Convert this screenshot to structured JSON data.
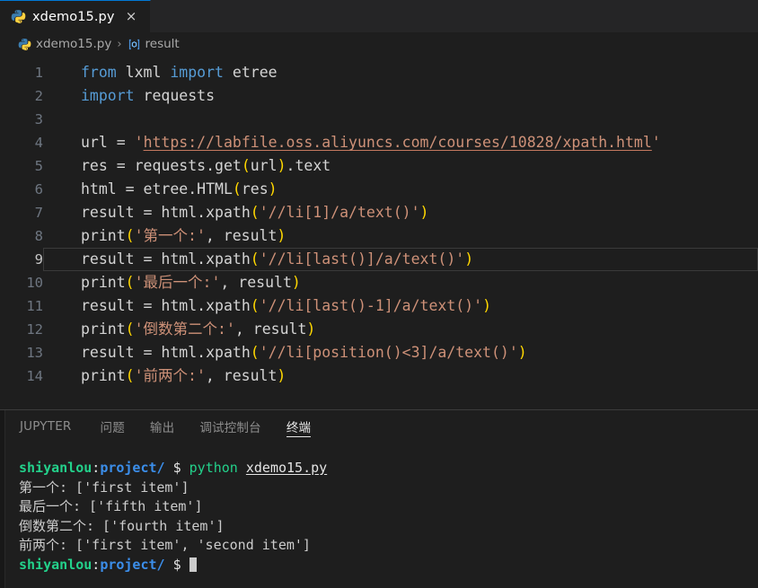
{
  "window": {
    "theme": "dark",
    "accent_color": "#0078d4",
    "editor_background": "#1e1e1e",
    "tabbar_background": "#252526"
  },
  "tabbar": {
    "tabs": [
      {
        "label": "xdemo15.py",
        "icon": "python-file-icon",
        "active": true,
        "close_label": "×"
      }
    ]
  },
  "breadcrumb": {
    "items": [
      {
        "label": "xdemo15.py",
        "icon": "python-file-icon"
      },
      {
        "label": "result",
        "icon": "symbol-variable-icon"
      }
    ],
    "separator": "›"
  },
  "editor": {
    "language": "python",
    "active_line": 9,
    "lines": [
      {
        "number": "1",
        "tokens": [
          {
            "t": "from",
            "c": "t-kw"
          },
          {
            "t": " lxml ",
            "c": "t-var"
          },
          {
            "t": "import",
            "c": "t-kw"
          },
          {
            "t": " etree",
            "c": "t-var"
          }
        ]
      },
      {
        "number": "2",
        "tokens": [
          {
            "t": "import",
            "c": "t-kw"
          },
          {
            "t": " requests",
            "c": "t-var"
          }
        ]
      },
      {
        "number": "3",
        "tokens": []
      },
      {
        "number": "4",
        "tokens": [
          {
            "t": "url ",
            "c": "t-var"
          },
          {
            "t": "= ",
            "c": "t-op"
          },
          {
            "t": "'",
            "c": "t-str"
          },
          {
            "t": "https://labfile.oss.aliyuncs.com/courses/10828/xpath.html",
            "c": "t-str-link"
          },
          {
            "t": "'",
            "c": "t-str"
          }
        ]
      },
      {
        "number": "5",
        "tokens": [
          {
            "t": "res ",
            "c": "t-var"
          },
          {
            "t": "= ",
            "c": "t-op"
          },
          {
            "t": "requests.get",
            "c": "t-var"
          },
          {
            "t": "(",
            "c": "t-p1"
          },
          {
            "t": "url",
            "c": "t-var"
          },
          {
            "t": ")",
            "c": "t-p1"
          },
          {
            "t": ".text",
            "c": "t-var"
          }
        ]
      },
      {
        "number": "6",
        "tokens": [
          {
            "t": "html ",
            "c": "t-var"
          },
          {
            "t": "= ",
            "c": "t-op"
          },
          {
            "t": "etree.HTML",
            "c": "t-var"
          },
          {
            "t": "(",
            "c": "t-p1"
          },
          {
            "t": "res",
            "c": "t-var"
          },
          {
            "t": ")",
            "c": "t-p1"
          }
        ]
      },
      {
        "number": "7",
        "tokens": [
          {
            "t": "result ",
            "c": "t-var"
          },
          {
            "t": "= ",
            "c": "t-op"
          },
          {
            "t": "html.xpath",
            "c": "t-var"
          },
          {
            "t": "(",
            "c": "t-p1"
          },
          {
            "t": "'//li[1]/a/text()'",
            "c": "t-str"
          },
          {
            "t": ")",
            "c": "t-p1"
          }
        ]
      },
      {
        "number": "8",
        "tokens": [
          {
            "t": "print",
            "c": "t-var"
          },
          {
            "t": "(",
            "c": "t-p1"
          },
          {
            "t": "'第一个:'",
            "c": "t-str"
          },
          {
            "t": ", ",
            "c": "t-op"
          },
          {
            "t": "result",
            "c": "t-var"
          },
          {
            "t": ")",
            "c": "t-p1"
          }
        ]
      },
      {
        "number": "9",
        "active": true,
        "tokens": [
          {
            "t": "result ",
            "c": "t-var"
          },
          {
            "t": "= ",
            "c": "t-op"
          },
          {
            "t": "html.xpath",
            "c": "t-var"
          },
          {
            "t": "(",
            "c": "t-p1"
          },
          {
            "t": "'//li[last()]/a/text()'",
            "c": "t-str"
          },
          {
            "t": ")",
            "c": "t-p1"
          }
        ]
      },
      {
        "number": "10",
        "tokens": [
          {
            "t": "print",
            "c": "t-var"
          },
          {
            "t": "(",
            "c": "t-p1"
          },
          {
            "t": "'最后一个:'",
            "c": "t-str"
          },
          {
            "t": ", ",
            "c": "t-op"
          },
          {
            "t": "result",
            "c": "t-var"
          },
          {
            "t": ")",
            "c": "t-p1"
          }
        ]
      },
      {
        "number": "11",
        "tokens": [
          {
            "t": "result ",
            "c": "t-var"
          },
          {
            "t": "= ",
            "c": "t-op"
          },
          {
            "t": "html.xpath",
            "c": "t-var"
          },
          {
            "t": "(",
            "c": "t-p1"
          },
          {
            "t": "'//li[last()-1]/a/text()'",
            "c": "t-str"
          },
          {
            "t": ")",
            "c": "t-p1"
          }
        ]
      },
      {
        "number": "12",
        "tokens": [
          {
            "t": "print",
            "c": "t-var"
          },
          {
            "t": "(",
            "c": "t-p1"
          },
          {
            "t": "'倒数第二个:'",
            "c": "t-str"
          },
          {
            "t": ", ",
            "c": "t-op"
          },
          {
            "t": "result",
            "c": "t-var"
          },
          {
            "t": ")",
            "c": "t-p1"
          }
        ]
      },
      {
        "number": "13",
        "tokens": [
          {
            "t": "result ",
            "c": "t-var"
          },
          {
            "t": "= ",
            "c": "t-op"
          },
          {
            "t": "html.xpath",
            "c": "t-var"
          },
          {
            "t": "(",
            "c": "t-p1"
          },
          {
            "t": "'//li[position()<3]/a/text()'",
            "c": "t-str"
          },
          {
            "t": ")",
            "c": "t-p1"
          }
        ]
      },
      {
        "number": "14",
        "tokens": [
          {
            "t": "print",
            "c": "t-var"
          },
          {
            "t": "(",
            "c": "t-p1"
          },
          {
            "t": "'前两个:'",
            "c": "t-str"
          },
          {
            "t": ", ",
            "c": "t-op"
          },
          {
            "t": "result",
            "c": "t-var"
          },
          {
            "t": ")",
            "c": "t-p1"
          }
        ]
      }
    ]
  },
  "panel": {
    "tabs": [
      {
        "label": "JUPYTER",
        "active": false
      },
      {
        "label": "问题",
        "active": false
      },
      {
        "label": "输出",
        "active": false
      },
      {
        "label": "调试控制台",
        "active": false
      },
      {
        "label": "终端",
        "active": true
      }
    ]
  },
  "terminal": {
    "lines": [
      {
        "type": "prompt",
        "segments": [
          {
            "t": "shiyanlou",
            "c": "tm-user"
          },
          {
            "t": ":",
            "c": "tm-colon"
          },
          {
            "t": "project/",
            "c": "tm-path"
          },
          {
            "t": " $ ",
            "c": "tm-dollar"
          },
          {
            "t": "python",
            "c": "tm-cmd"
          },
          {
            "t": " ",
            "c": "tm-out"
          },
          {
            "t": "xdemo15.py",
            "c": "tm-file"
          }
        ]
      },
      {
        "type": "output",
        "segments": [
          {
            "t": "第一个: ['first item']",
            "c": "tm-out"
          }
        ]
      },
      {
        "type": "output",
        "segments": [
          {
            "t": "最后一个: ['fifth item']",
            "c": "tm-out"
          }
        ]
      },
      {
        "type": "output",
        "segments": [
          {
            "t": "倒数第二个: ['fourth item']",
            "c": "tm-out"
          }
        ]
      },
      {
        "type": "output",
        "segments": [
          {
            "t": "前两个: ['first item', 'second item']",
            "c": "tm-out"
          }
        ]
      },
      {
        "type": "prompt",
        "cursor": true,
        "segments": [
          {
            "t": "shiyanlou",
            "c": "tm-user"
          },
          {
            "t": ":",
            "c": "tm-colon"
          },
          {
            "t": "project/",
            "c": "tm-path"
          },
          {
            "t": " $ ",
            "c": "tm-dollar"
          }
        ]
      }
    ]
  }
}
